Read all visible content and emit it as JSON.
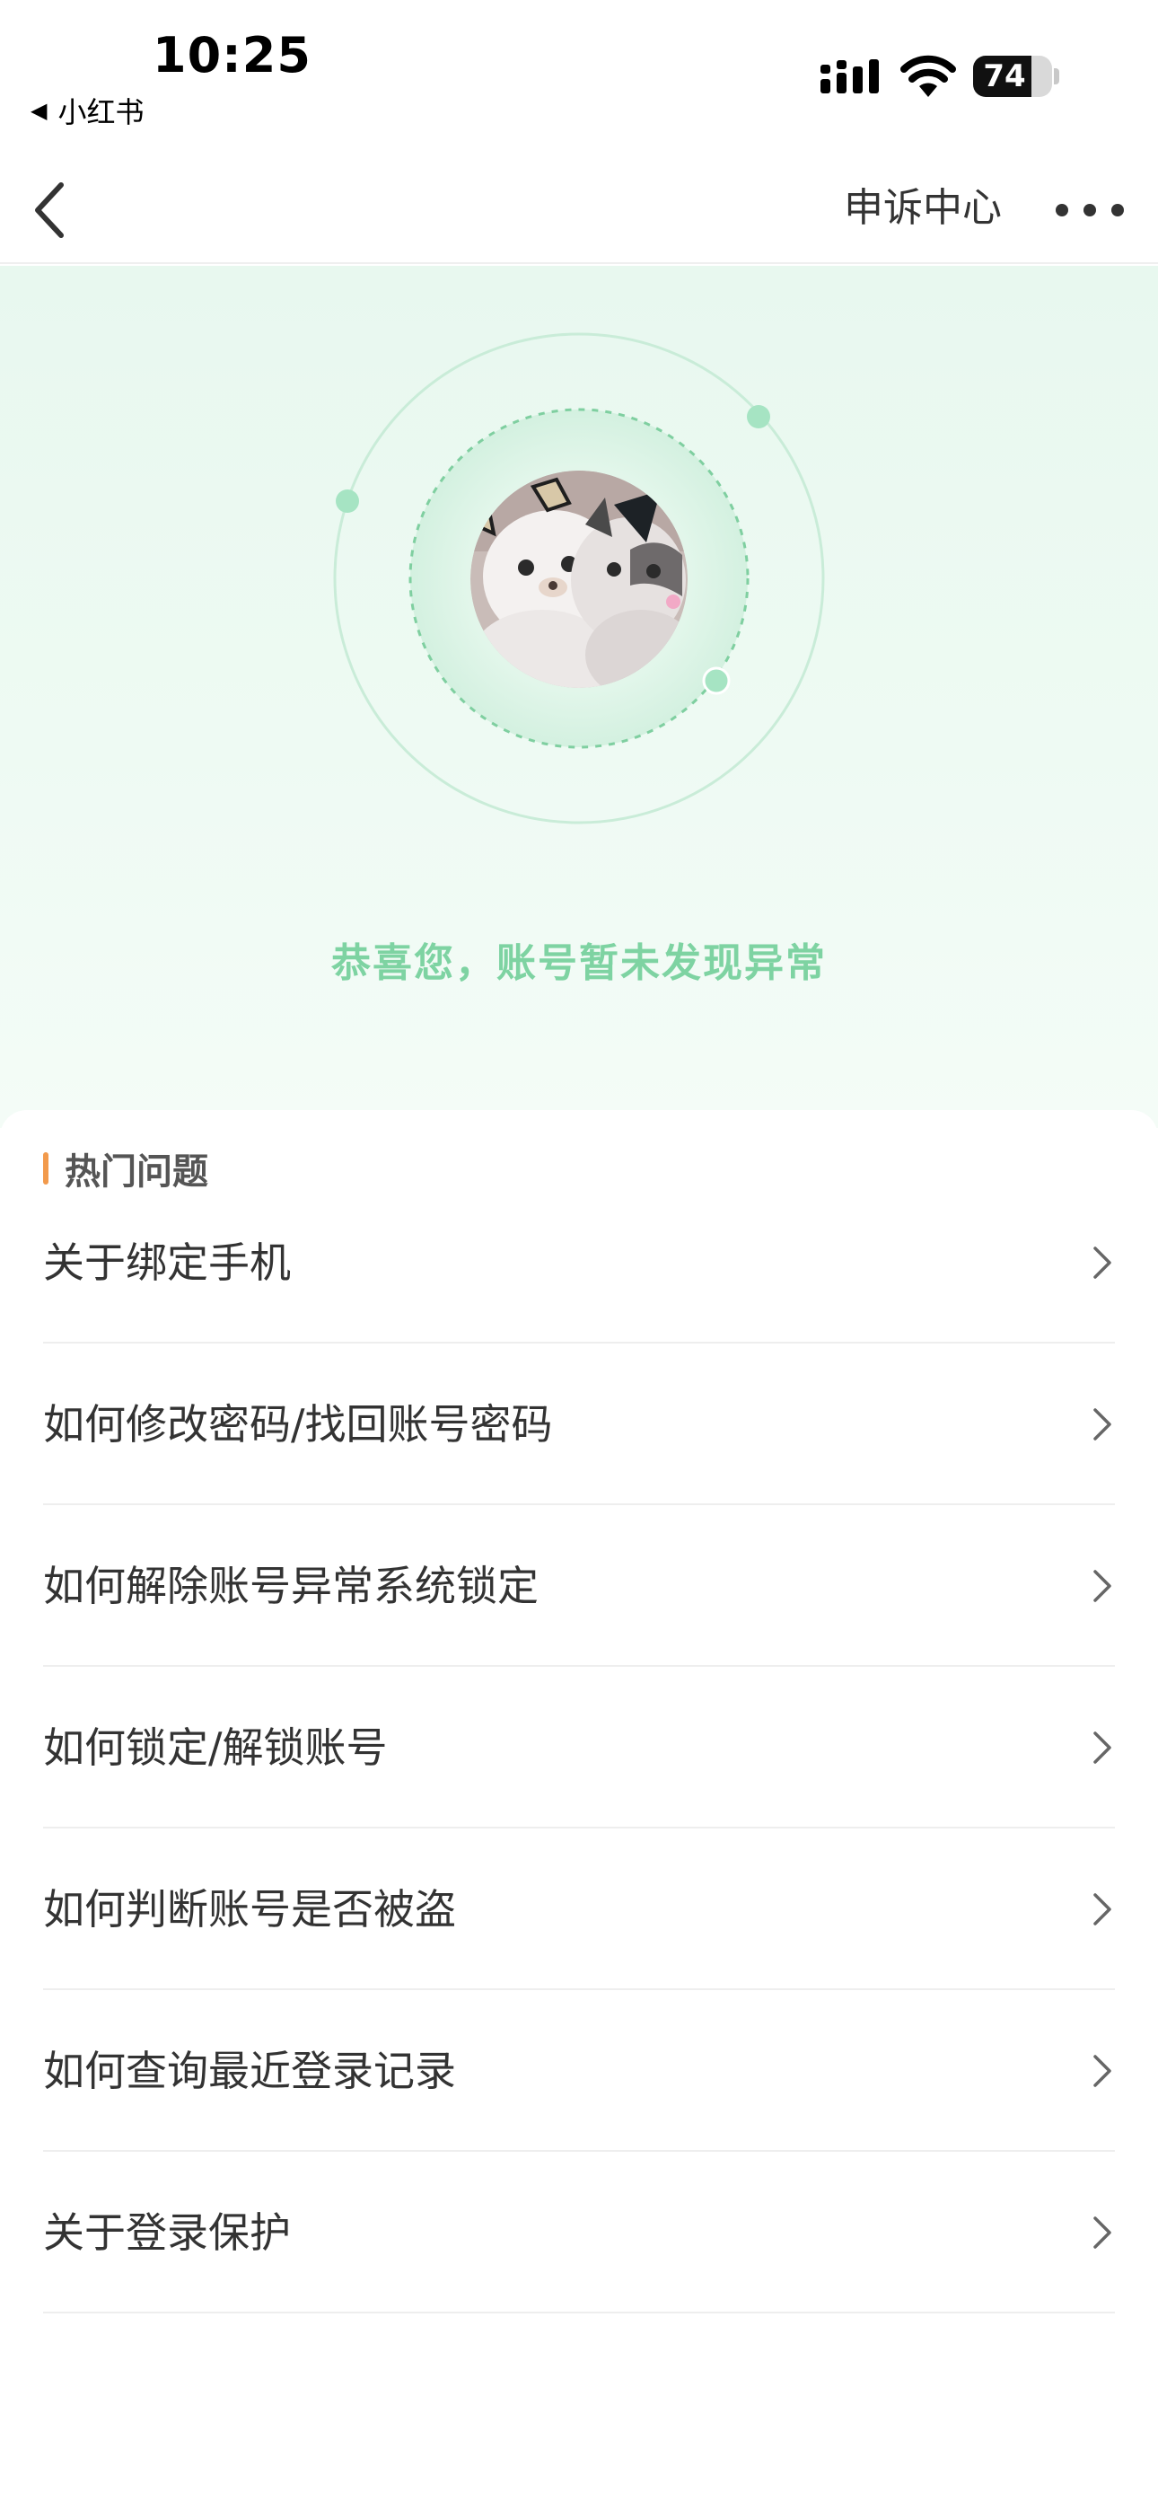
{
  "status_bar": {
    "time": "10:25",
    "back_app_label": "小红书",
    "battery_level": "74",
    "icons": [
      "signal-icon",
      "wifi-icon",
      "battery-icon"
    ]
  },
  "nav": {
    "title": "申诉中心",
    "back_icon": "chevron-left-icon",
    "more_icon": "more-dots-icon"
  },
  "hero": {
    "message": "恭喜您，账号暂未发现异常",
    "avatar": "avatar-kittens"
  },
  "section": {
    "title": "热门问题"
  },
  "faq_items": [
    {
      "label": "关于绑定手机"
    },
    {
      "label": "如何修改密码/找回账号密码"
    },
    {
      "label": "如何解除账号异常系统锁定"
    },
    {
      "label": "如何锁定/解锁账号"
    },
    {
      "label": "如何判断账号是否被盗"
    },
    {
      "label": "如何查询最近登录记录"
    },
    {
      "label": "关于登录保护"
    }
  ],
  "colors": {
    "accent_green": "#7ed3a2",
    "section_bar": "#f29a4c",
    "hero_bg": "#e8f8ef"
  }
}
